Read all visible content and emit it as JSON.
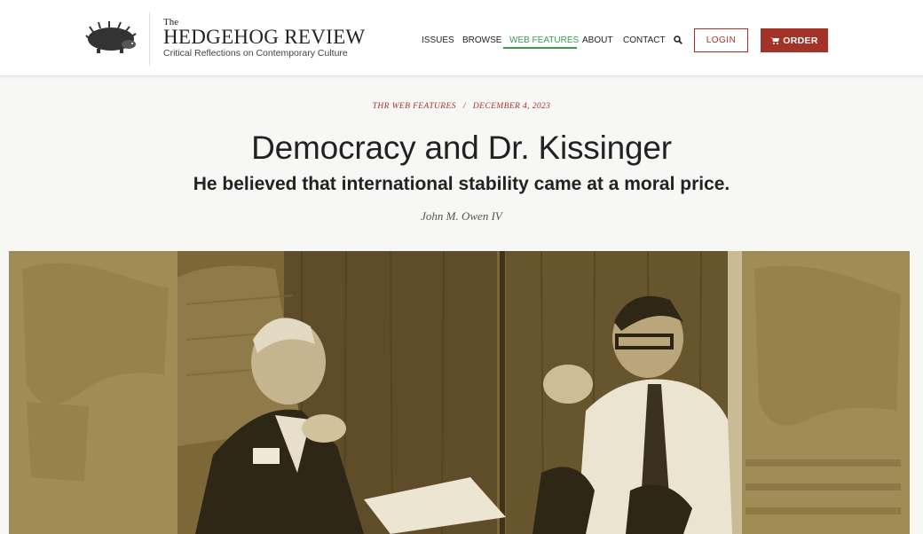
{
  "header": {
    "brand_the": "The",
    "brand_name": "HEDGEHOG REVIEW",
    "brand_tagline": "Critical Reflections on Contemporary Culture",
    "logo_icon": "hedgehog-icon",
    "nav": [
      "ISSUES",
      "BROWSE",
      "WEB FEATURES",
      "ABOUT",
      "CONTACT"
    ],
    "active_nav": "WEB FEATURES",
    "search_icon": "search-icon",
    "login_label": "LOGIN",
    "order_label": "ORDER",
    "order_icon": "cart-icon"
  },
  "article": {
    "section": "THR WEB FEATURES",
    "separator": "/",
    "date": "DECEMBER 4, 2023",
    "title": "Democracy and Dr. Kissinger",
    "subtitle": "He believed that international stability came at a moral price.",
    "author": "John M. Owen IV"
  },
  "colors": {
    "accent_red": "#a33328",
    "active_green": "#3a9b4e",
    "hero_tint": "#a08b4a"
  }
}
